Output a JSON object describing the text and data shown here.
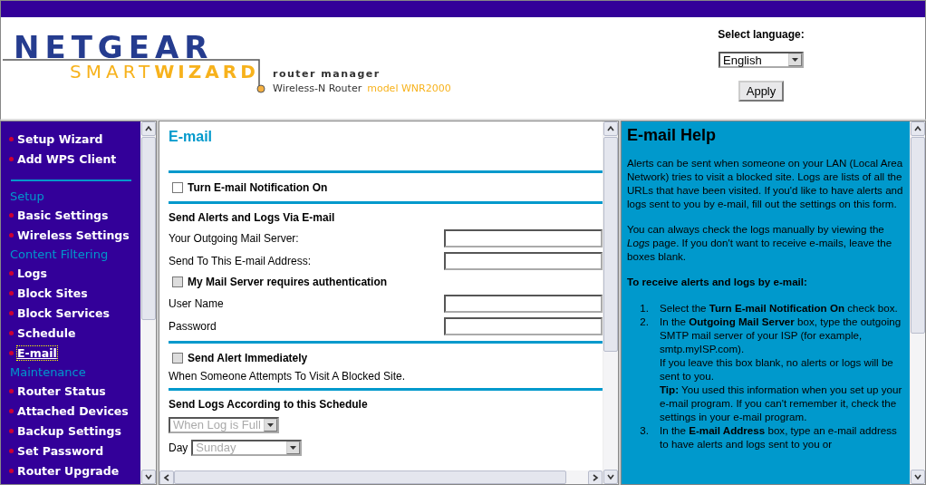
{
  "header": {
    "logo": {
      "brand": "NETGEAR",
      "product_light": "SMART",
      "product_bold": "WIZARD",
      "tagline": "router manager",
      "device": "Wireless-N Router",
      "model": "model WNR2000"
    },
    "language": {
      "label": "Select language:",
      "value": "English"
    },
    "apply_button": "Apply"
  },
  "sidebar": {
    "top_items": [
      {
        "label": "Setup Wizard",
        "selected": false
      },
      {
        "label": "Add WPS Client",
        "selected": false
      }
    ],
    "sections": [
      {
        "heading": "Setup",
        "items": [
          {
            "label": "Basic Settings",
            "selected": false
          },
          {
            "label": "Wireless Settings",
            "selected": false
          }
        ]
      },
      {
        "heading": "Content Filtering",
        "items": [
          {
            "label": "Logs",
            "selected": false
          },
          {
            "label": "Block Sites",
            "selected": false
          },
          {
            "label": "Block Services",
            "selected": false
          },
          {
            "label": "Schedule",
            "selected": false
          },
          {
            "label": "E-mail",
            "selected": true
          }
        ]
      },
      {
        "heading": "Maintenance",
        "items": [
          {
            "label": "Router Status",
            "selected": false
          },
          {
            "label": "Attached Devices",
            "selected": false
          },
          {
            "label": "Backup Settings",
            "selected": false
          },
          {
            "label": "Set Password",
            "selected": false
          },
          {
            "label": "Router Upgrade",
            "selected": false
          }
        ]
      }
    ]
  },
  "form": {
    "title": "E-mail",
    "sections": [
      {
        "rows": [
          {
            "kind": "checkbox",
            "label": "Turn E-mail Notification On",
            "checked": false,
            "disabled": false
          }
        ]
      },
      {
        "rows": [
          {
            "kind": "heading",
            "label": "Send Alerts and Logs Via E-mail"
          },
          {
            "kind": "field",
            "label": "Your Outgoing Mail Server:"
          },
          {
            "kind": "field",
            "label": "Send To This E-mail Address:"
          },
          {
            "kind": "checkbox",
            "label": "My Mail Server requires authentication",
            "checked": false,
            "disabled": true
          },
          {
            "kind": "field",
            "label": "User Name"
          },
          {
            "kind": "field",
            "label": "Password"
          }
        ]
      },
      {
        "rows": [
          {
            "kind": "checkbox",
            "label": "Send Alert Immediately",
            "checked": false,
            "disabled": true
          },
          {
            "kind": "note",
            "label": "When Someone Attempts To Visit A Blocked Site."
          }
        ]
      },
      {
        "rows": [
          {
            "kind": "heading",
            "label": "Send Logs According to this Schedule"
          },
          {
            "kind": "select",
            "value": "When Log is Full",
            "disabled": true
          },
          {
            "kind": "select",
            "label": "Day",
            "value": "Sunday",
            "disabled": true
          }
        ]
      }
    ]
  },
  "help": {
    "title": "E-mail Help",
    "paragraphs": [
      "Alerts can be sent when someone on your LAN (Local Area Network) tries to visit a blocked site. Logs are lists of all the URLs that have been visited. If you'd like to have alerts and logs sent to you by e-mail, fill out the settings on this form.",
      "You can always check the logs manually by viewing the *Logs* page. If you don't want to receive e-mails, leave the boxes blank."
    ],
    "steps_heading": "To receive alerts and logs by e-mail:",
    "steps": [
      {
        "number": "1.",
        "lines": [
          "Select the **Turn E-mail Notification On** check box."
        ]
      },
      {
        "number": "2.",
        "lines": [
          "In the **Outgoing Mail Server** box, type the outgoing SMTP mail server of your ISP (for example, smtp.myISP.com).",
          "If you leave this box blank, no alerts or logs will be sent to you.",
          "**Tip:** You used this information when you set up your e-mail program. If you can't remember it, check the settings in your e-mail program."
        ]
      },
      {
        "number": "3.",
        "lines": [
          "In the **E-mail Address** box, type an e-mail address to have alerts and logs sent to you or"
        ]
      }
    ]
  }
}
